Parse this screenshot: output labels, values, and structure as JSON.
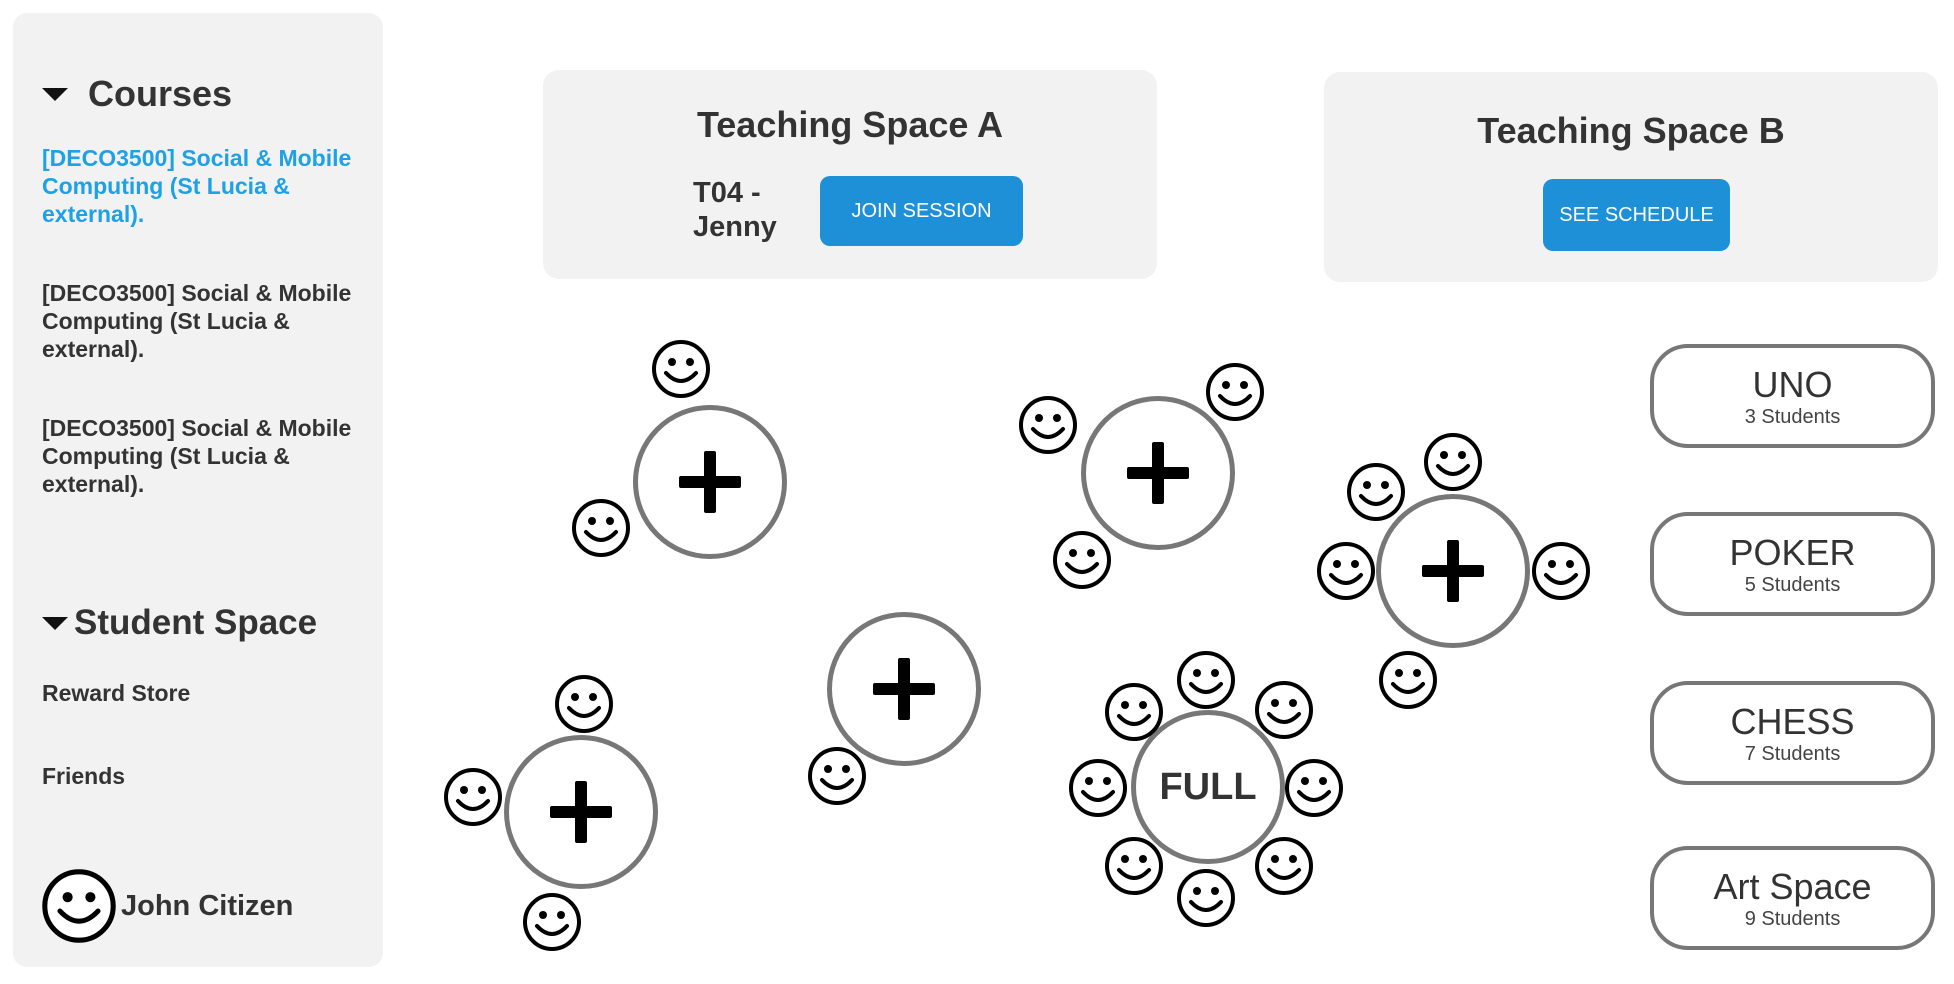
{
  "sidebar": {
    "courses_heading": "Courses",
    "courses": [
      {
        "label": "[DECO3500] Social & Mobile Computing (St Lucia & external).",
        "active": true
      },
      {
        "label": "[DECO3500] Social & Mobile Computing (St Lucia & external).",
        "active": false
      },
      {
        "label": "[DECO3500] Social & Mobile Computing (St Lucia & external).",
        "active": false
      }
    ],
    "student_space_heading": "Student Space",
    "links": [
      "Reward Store",
      "Friends"
    ],
    "user": {
      "name": "John Citizen",
      "icon": "smiley-avatar-icon"
    }
  },
  "teaching_space_a": {
    "title": "Teaching Space A",
    "session": "T04 - Jenny",
    "button": "JOIN SESSION"
  },
  "teaching_space_b": {
    "title": "Teaching Space B",
    "button": "SEE SCHEDULE"
  },
  "tables": [
    {
      "state": "join",
      "icon": "plus-icon",
      "occupants": 2
    },
    {
      "state": "join",
      "icon": "plus-icon",
      "occupants": 3
    },
    {
      "state": "join",
      "icon": "plus-icon",
      "occupants": 5
    },
    {
      "state": "join",
      "icon": "plus-icon",
      "occupants": 1
    },
    {
      "state": "full",
      "label": "FULL",
      "occupants": 8
    },
    {
      "state": "join",
      "icon": "plus-icon",
      "occupants": 3
    }
  ],
  "game_rooms": [
    {
      "name": "UNO",
      "count": "3 Students"
    },
    {
      "name": "POKER",
      "count": "5 Students"
    },
    {
      "name": "CHESS",
      "count": "7 Students"
    },
    {
      "name": "Art Space",
      "count": "9 Students"
    }
  ],
  "colors": {
    "accent": "#1ea1e6",
    "button": "#1e90d8",
    "panel": "#f2f2f2",
    "table_border": "#777777"
  }
}
